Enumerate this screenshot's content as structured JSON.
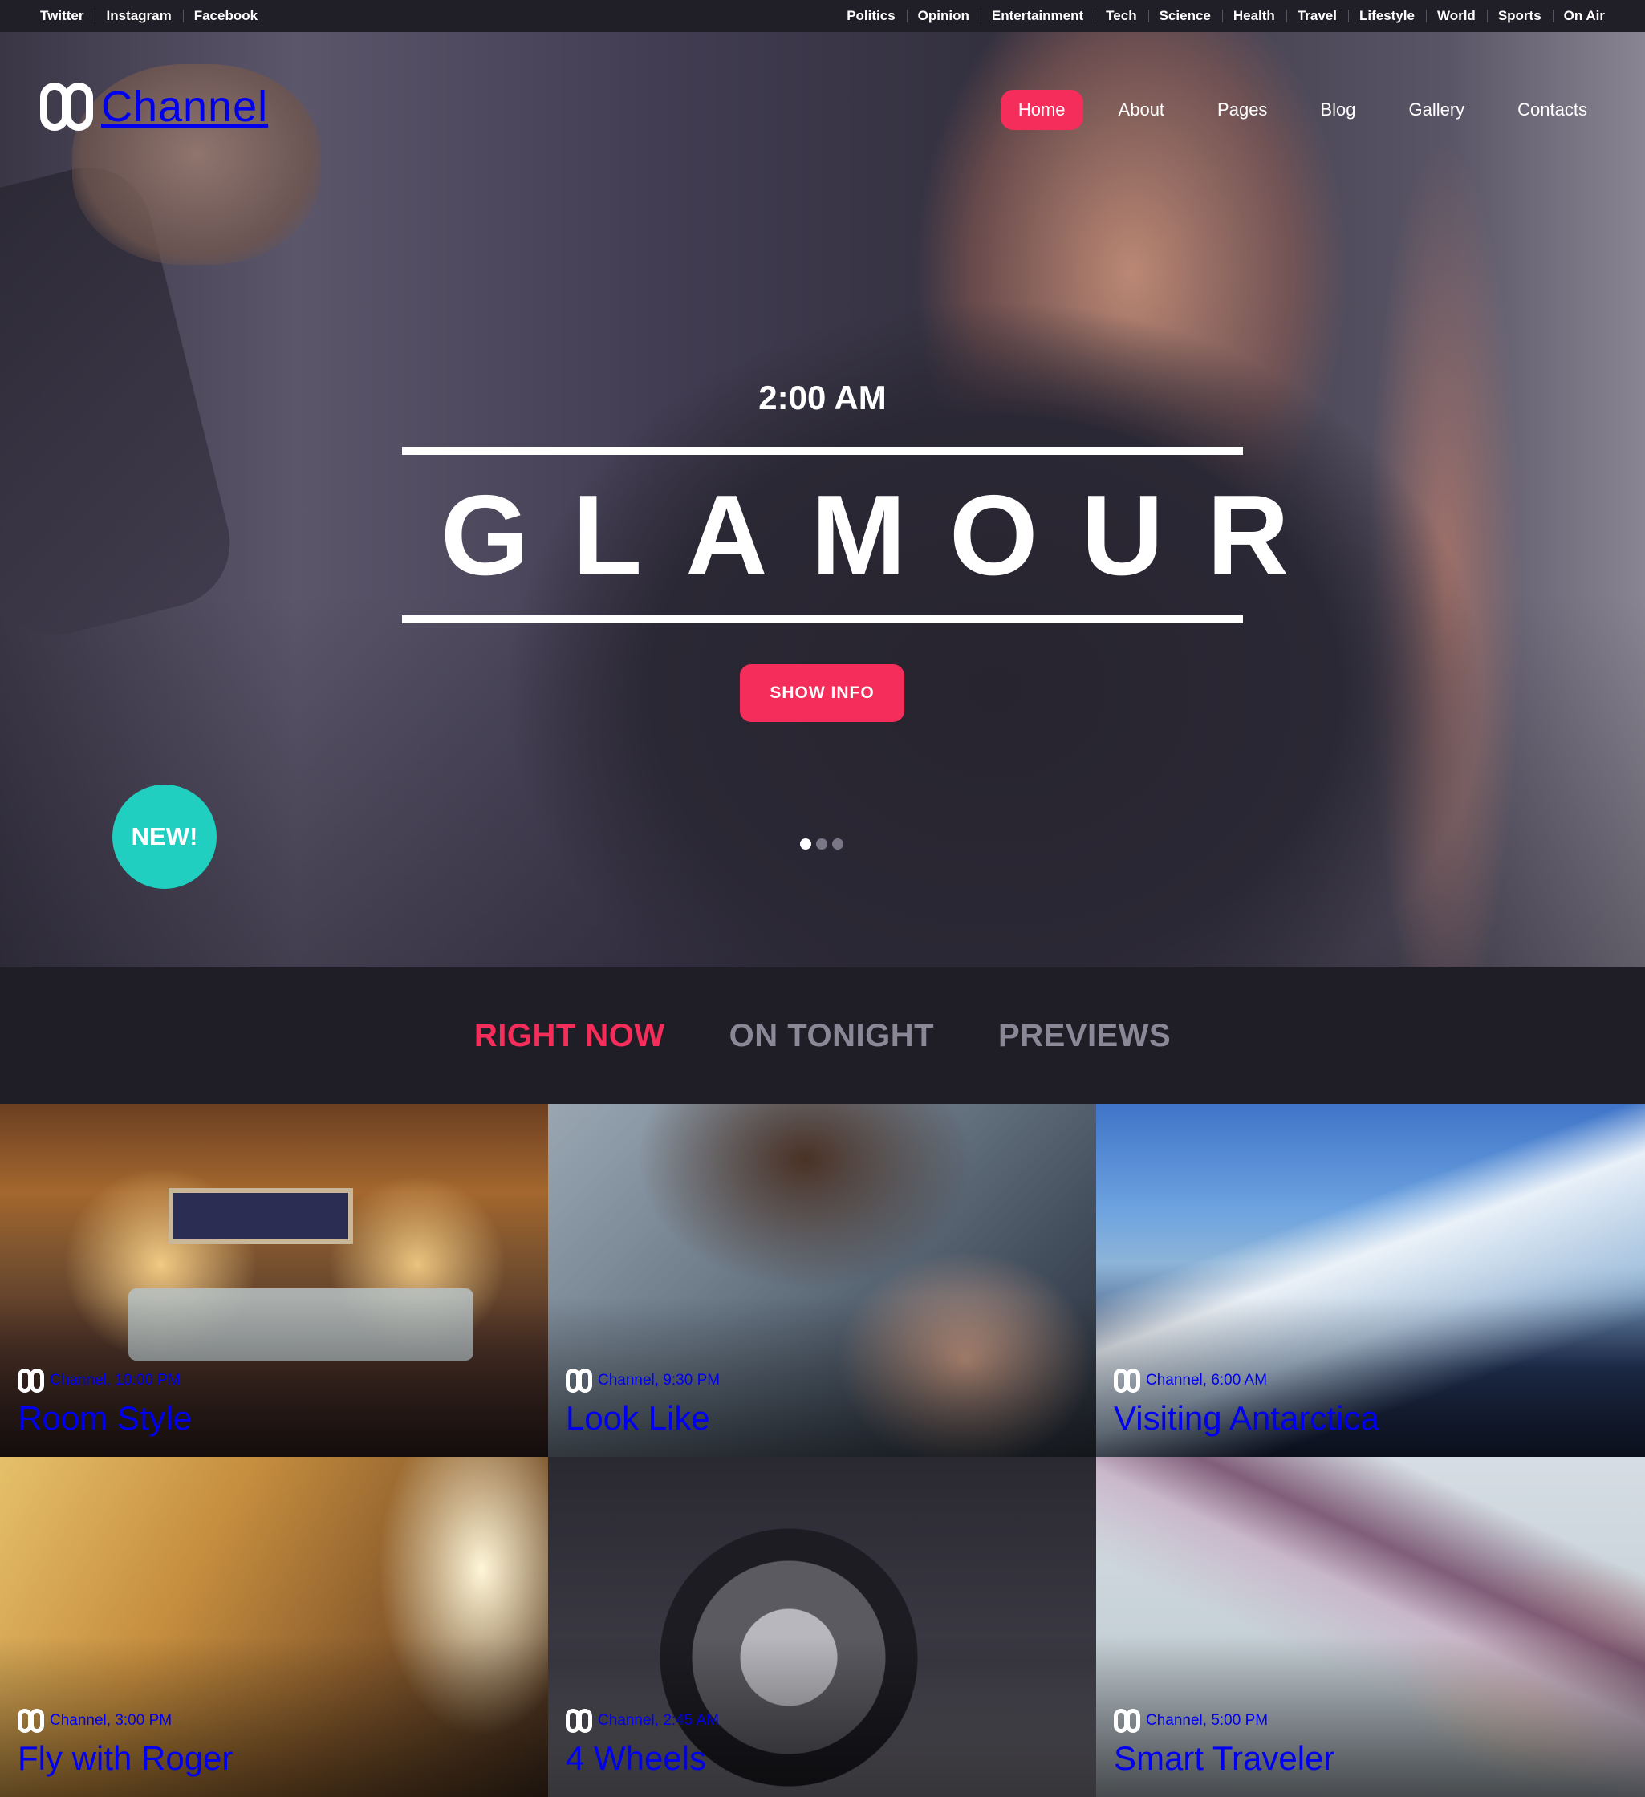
{
  "topbar": {
    "social": [
      "Twitter",
      "Instagram",
      "Facebook"
    ],
    "categories": [
      "Politics",
      "Opinion",
      "Entertainment",
      "Tech",
      "Science",
      "Health",
      "Travel",
      "Lifestyle",
      "World",
      "Sports",
      "On Air"
    ]
  },
  "brand": {
    "mark": "88",
    "name": "Channel"
  },
  "nav": {
    "items": [
      "Home",
      "About",
      "Pages",
      "Blog",
      "Gallery",
      "Contacts"
    ],
    "active": "Home"
  },
  "hero": {
    "time": "2:00 AM",
    "title": "GLAMOUR",
    "button_label": "SHOW INFO",
    "badge": "NEW!",
    "slides": {
      "count": 3,
      "active_index": 0
    }
  },
  "tabs": {
    "items": [
      "RIGHT NOW",
      "ON TONIGHT",
      "PREVIEWS"
    ],
    "active": "RIGHT NOW"
  },
  "cards": [
    {
      "meta": "Channel, 10:00 PM",
      "title": "Room Style"
    },
    {
      "meta": "Channel, 9:30 PM",
      "title": "Look Like"
    },
    {
      "meta": "Channel, 6:00 AM",
      "title": "Visiting Antarctica"
    },
    {
      "meta": "Channel, 3:00 PM",
      "title": "Fly with Roger"
    },
    {
      "meta": "Channel, 2:45 AM",
      "title": "4 Wheels"
    },
    {
      "meta": "Channel, 5:00 PM",
      "title": "Smart Traveler"
    }
  ],
  "colors": {
    "accent": "#f52d5a",
    "badge": "#20cfc0",
    "background": "#1f1e26"
  }
}
